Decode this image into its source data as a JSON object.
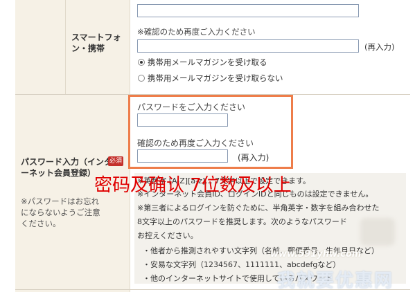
{
  "smartphone": {
    "label": "スマートフォン・携帯",
    "confirm_note": "※確認のため再度ご入力ください",
    "reinput": "(再入力)",
    "radio_receive": "携帯用メールマガジンを受け取る",
    "radio_not_receive": "携帯用メールマガジンを受け取らない"
  },
  "password": {
    "title": "パスワード入力（インターネット会員登録）",
    "required": "必須",
    "side_note": "※パスワードはお忘れにならないようご注意ください。",
    "prompt": "パスワードをご入力ください",
    "confirm_note": "確認のため再度ご入力ください",
    "reinput": "(再入力)"
  },
  "info_lines": [
    "※英数字 [A-Z][a-z]... 7文字以上で設定できます。",
    "※インターネット会員ID、ログインIDと同じものは設定できません。",
    "※第三者によるログインを防ぐために、半角英字・数字を組み合わせた",
    "8文字以上のパスワードを推奨します。次のようなパスワード",
    "お控えください。",
    "・他者から推測されやすい文字列（名前、郵便番号、生年月日など）",
    "・安易な文字列（1234567、1111111、abcdefgなど）",
    "・他のインターネットサイトで使用しているパスワード"
  ],
  "overlay_caption": "密码及确认 7位数及以上",
  "watermark": {
    "url": "www.591yhw.com",
    "cn": "我就要优惠网"
  },
  "colors": {
    "panel": "#f6f1e6",
    "highlight": "#ee7d4a",
    "required": "#c4302b",
    "caption": "#e00000"
  }
}
